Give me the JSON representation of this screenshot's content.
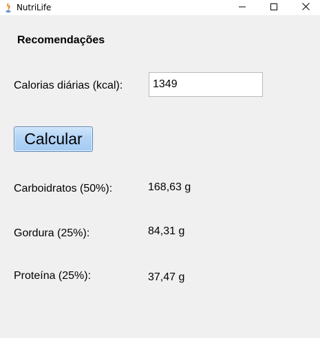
{
  "window": {
    "title": "NutriLife",
    "controls": {
      "minimize_icon": "minimize-icon",
      "maximize_icon": "maximize-icon",
      "close_icon": "close-icon"
    }
  },
  "form": {
    "heading": "Recomendações",
    "calories_label": "Calorias diárias (kcal):",
    "calories_value": "1349",
    "calculate_label": "Calcular"
  },
  "results": {
    "carbs_label": "Carboidratos (50%):",
    "carbs_value": "168,63 g",
    "fat_label": "Gordura (25%):",
    "fat_value": "84,31 g",
    "protein_label": "Proteína (25%):",
    "protein_value": "37,47 g"
  },
  "colors": {
    "button_fill": "#b3d4f6",
    "button_border": "#5c84b3",
    "background": "#f0f0f0"
  }
}
